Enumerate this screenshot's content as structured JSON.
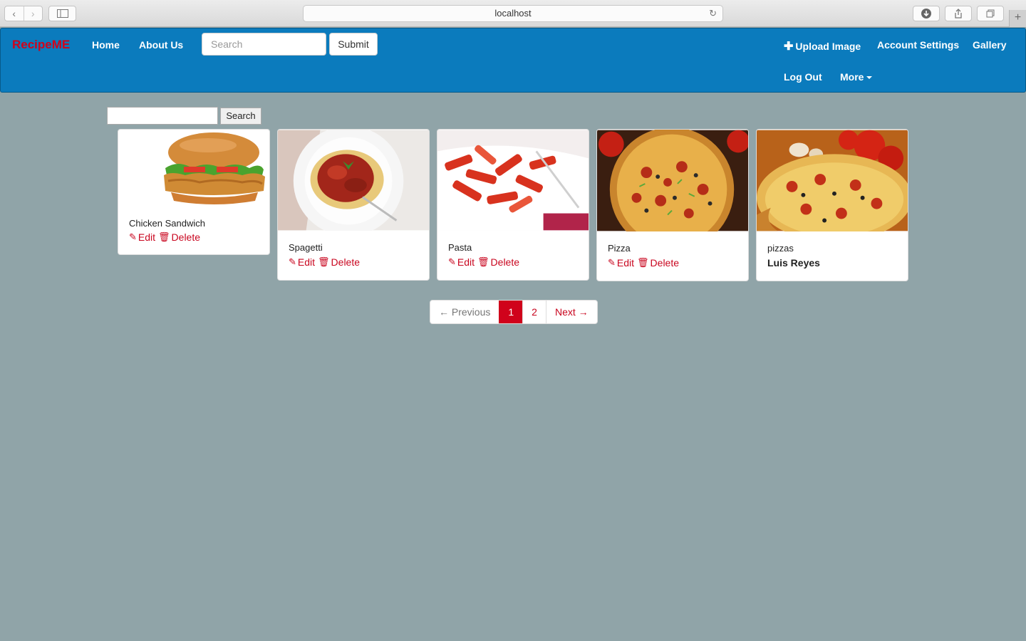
{
  "browser": {
    "url": "localhost",
    "back_icon": "chevron-left",
    "forward_icon": "chevron-right"
  },
  "navbar": {
    "brand": "RecipeME",
    "links": [
      "Home",
      "About Us"
    ],
    "search_placeholder": "Search",
    "submit_label": "Submit",
    "right_links": [
      "Upload Image",
      "Account Settings",
      "Gallery"
    ],
    "logout_label": "Log Out",
    "more_label": "More",
    "colors": {
      "bar": "#0b7bbd",
      "brand": "#d0021b"
    }
  },
  "page_search": {
    "button_label": "Search",
    "value": ""
  },
  "cards": [
    {
      "title": "Chicken Sandwich",
      "edit_label": "Edit",
      "delete_label": "Delete",
      "image": "chicken-sandwich"
    },
    {
      "title": "Spagetti",
      "edit_label": "Edit",
      "delete_label": "Delete",
      "image": "spaghetti"
    },
    {
      "title": "Pasta",
      "edit_label": "Edit",
      "delete_label": "Delete",
      "image": "penne-pasta"
    },
    {
      "title": "Pizza",
      "edit_label": "Edit",
      "delete_label": "Delete",
      "image": "pizza"
    },
    {
      "title": "pizzas",
      "author": "Luis Reyes",
      "image": "pizza-with-tomatoes"
    }
  ],
  "pagination": {
    "previous_label": "← Previous",
    "pages": [
      "1",
      "2"
    ],
    "current_page": "1",
    "next_label": "Next →"
  }
}
